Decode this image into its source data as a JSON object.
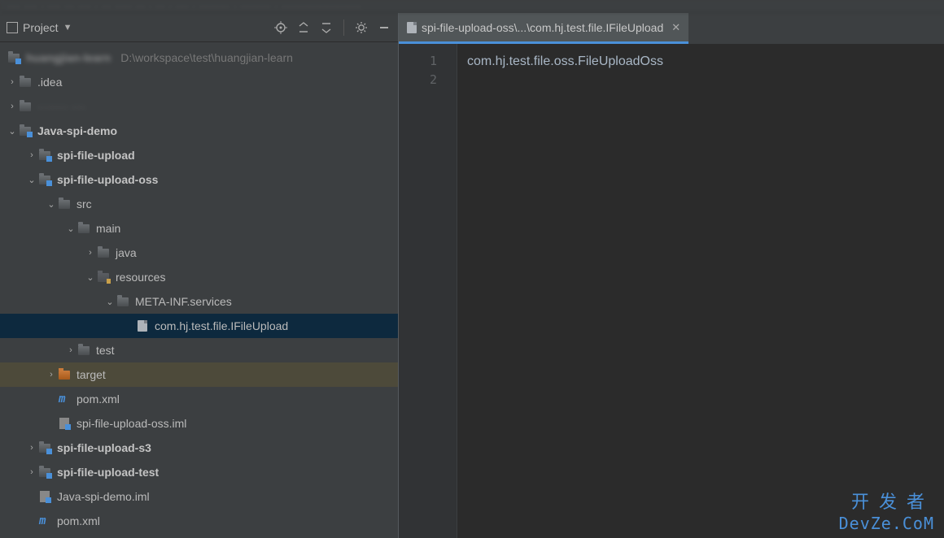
{
  "panel": {
    "title": "Project"
  },
  "path_hint": "D:\\workspace\\test\\huangjian-learn",
  "tree": {
    "idea": ".idea",
    "mod": "Java-spi-demo",
    "upload": "spi-file-upload",
    "upload_oss": "spi-file-upload-oss",
    "src": "src",
    "main": "main",
    "java": "java",
    "resources": "resources",
    "meta": "META-INF.services",
    "ifile": "com.hj.test.file.IFileUpload",
    "test": "test",
    "target": "target",
    "pom": "pom.xml",
    "iml_oss": "spi-file-upload-oss.iml",
    "s3": "spi-file-upload-s3",
    "upload_test": "spi-file-upload-test",
    "iml_demo": "Java-spi-demo.iml",
    "pom2": "pom.xml"
  },
  "tab": {
    "label": "spi-file-upload-oss\\...\\com.hj.test.file.IFileUpload"
  },
  "editor": {
    "lines": {
      "l1": "1",
      "l2": "2"
    },
    "code1": "com.hj.test.file.oss.FileUploadOss"
  },
  "watermark": {
    "cn": "开发者",
    "en": "DevZe.CoM"
  }
}
